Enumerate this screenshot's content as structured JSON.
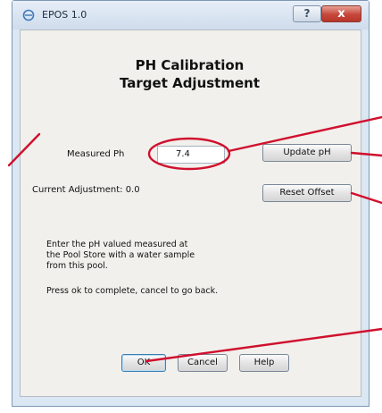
{
  "window": {
    "title": "EPOS 1.0",
    "help_glyph": "?",
    "close_glyph": "x"
  },
  "dialog": {
    "heading_line1": "PH Calibration",
    "heading_line2": "Target Adjustment",
    "measured_label": "Measured Ph",
    "measured_value": "7.4",
    "update_button": "Update pH",
    "current_adjustment": "Current Adjustment:  0.0",
    "reset_button": "Reset Offset",
    "instructions_1": "Enter the pH valued measured at",
    "instructions_2": "the Pool Store with a water sample",
    "instructions_3": "from this pool.",
    "instructions_4": "Press ok to complete, cancel to go back.",
    "ok_button": "OK",
    "cancel_button": "Cancel",
    "help_button": "Help"
  },
  "colors": {
    "annotation": "#d0102e",
    "close": "#c6473a"
  }
}
